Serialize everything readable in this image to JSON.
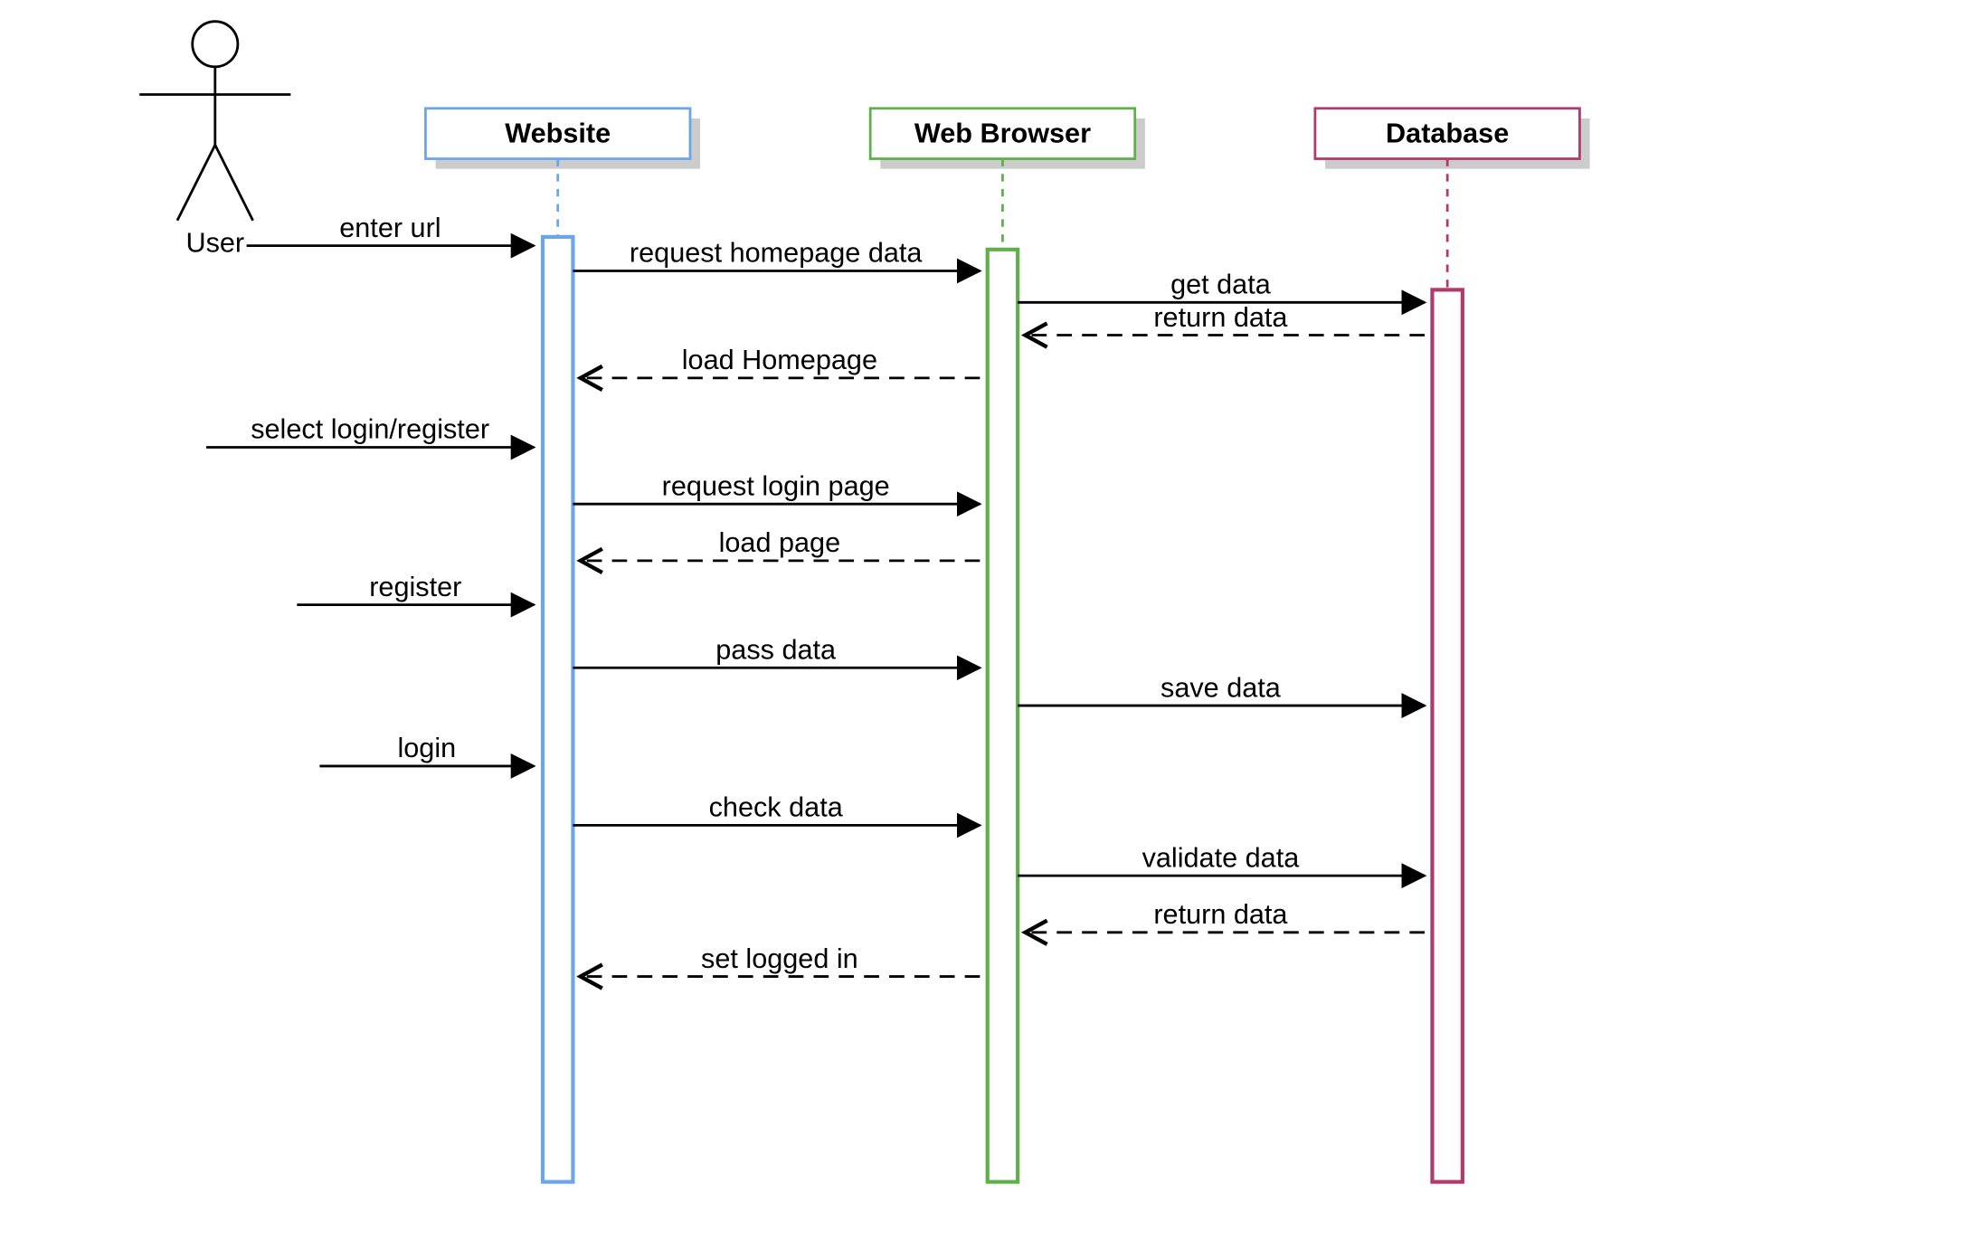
{
  "actor": {
    "label": "User"
  },
  "lifelines": {
    "website": {
      "label": "Website",
      "color": "#6aa6e8"
    },
    "browser": {
      "label": "Web Browser",
      "color": "#5fb04a"
    },
    "database": {
      "label": "Database",
      "color": "#b03a6b"
    }
  },
  "messages": {
    "m1": "enter url",
    "m2": "request homepage data",
    "m3": "get data",
    "m4": "return data",
    "m5": "load Homepage",
    "m6": "select login/register",
    "m7": "request login page",
    "m8": "load page",
    "m9": "register",
    "m10": "pass data",
    "m11": "save data",
    "m12": "login",
    "m13": "check data",
    "m14": "validate data",
    "m15": "return data",
    "m16": "set logged in"
  }
}
